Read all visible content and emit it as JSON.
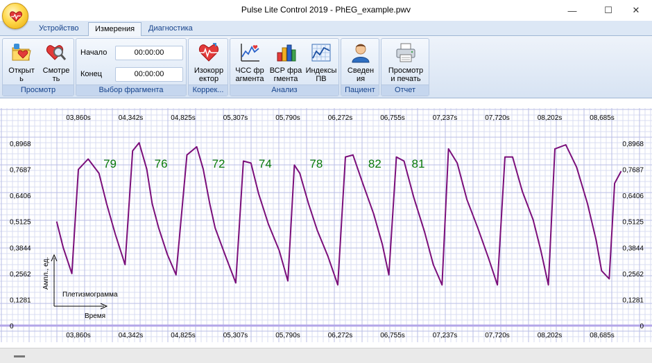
{
  "window": {
    "title": "Pulse Lite Control 2019 - PhEG_example.pwv",
    "minimize_glyph": "—",
    "maximize_glyph": "☐",
    "close_glyph": "✕"
  },
  "tabs": [
    {
      "label": "Устройство",
      "active": false
    },
    {
      "label": "Измерения",
      "active": true
    },
    {
      "label": "Диагностика",
      "active": false
    }
  ],
  "ribbon": {
    "view_group": {
      "label": "Просмотр",
      "open_button": "Открыт\nь",
      "view_button": "Смотре\nть",
      "open_icon": "folder-heart-icon",
      "view_icon": "heart-magnifier-icon"
    },
    "fragment_group": {
      "label": "Выбор фрагмента",
      "start_label": "Начало",
      "start_value": "00:00:00",
      "end_label": "Конец",
      "end_value": "00:00:00"
    },
    "correct_group": {
      "label": "Коррек...",
      "corrector_button": "Изокорр\nектор",
      "corrector_icon": "heart-pulse-icon"
    },
    "analysis_group": {
      "label": "Анализ",
      "hr_button": "ЧСС фр\nагмента",
      "hrv_button": "ВСР фра\nгмента",
      "pw_button": "Индексы\nПВ",
      "hr_icon": "line-chart-icon",
      "hrv_icon": "bar-chart-icon",
      "pw_icon": "grid-chart-icon"
    },
    "patient_group": {
      "label": "Пациент",
      "info_button": "Сведен\nия",
      "info_icon": "person-icon"
    },
    "report_group": {
      "label": "Отчет",
      "print_button": "Просмотр\nи печать",
      "print_icon": "printer-icon"
    }
  },
  "chart_data": {
    "type": "line",
    "x_ticks": [
      "03,860s",
      "04,342s",
      "04,825s",
      "05,307s",
      "05,790s",
      "06,272s",
      "06,755s",
      "07,237s",
      "07,720s",
      "08,202s",
      "08,685s"
    ],
    "y_ticks": [
      "0",
      "0,1281",
      "0,2562",
      "0,3844",
      "0,5125",
      "0,6406",
      "0,7687",
      "0,8968"
    ],
    "ylim": [
      0,
      0.8968
    ],
    "ylabel": "Ампл., ед.",
    "xlabel": "Время",
    "series_caption": "Плетизмограмма",
    "pulse_rates": [
      "79",
      "76",
      "72",
      "74",
      "78",
      "82",
      "81"
    ],
    "line_color": "#7a0e7a",
    "grid": true,
    "x_seconds": [
      3.66,
      3.72,
      3.8,
      3.86,
      3.95,
      4.05,
      4.12,
      4.2,
      4.29,
      4.36,
      4.42,
      4.49,
      4.54,
      4.6,
      4.68,
      4.76,
      4.86,
      4.95,
      5.01,
      5.07,
      5.12,
      5.21,
      5.31,
      5.38,
      5.45,
      5.52,
      5.61,
      5.71,
      5.79,
      5.85,
      5.9,
      5.98,
      6.06,
      6.16,
      6.25,
      6.32,
      6.39,
      6.48,
      6.58,
      6.66,
      6.72,
      6.79,
      6.86,
      6.95,
      7.05,
      7.13,
      7.21,
      7.27,
      7.35,
      7.44,
      7.54,
      7.64,
      7.72,
      7.79,
      7.86,
      7.95,
      8.05,
      8.12,
      8.19,
      8.25,
      8.35,
      8.45,
      8.55,
      8.63,
      8.68,
      8.75,
      8.8,
      8.86
    ],
    "values": [
      0.5125,
      0.3844,
      0.2562,
      0.7687,
      0.82,
      0.75,
      0.6,
      0.45,
      0.3,
      0.86,
      0.9,
      0.77,
      0.6,
      0.48,
      0.35,
      0.25,
      0.84,
      0.88,
      0.77,
      0.6,
      0.48,
      0.35,
      0.21,
      0.81,
      0.8,
      0.65,
      0.5,
      0.37,
      0.22,
      0.79,
      0.75,
      0.6,
      0.47,
      0.34,
      0.2,
      0.83,
      0.84,
      0.7,
      0.55,
      0.4,
      0.25,
      0.83,
      0.81,
      0.63,
      0.46,
      0.3,
      0.2,
      0.87,
      0.8,
      0.62,
      0.48,
      0.33,
      0.2,
      0.83,
      0.83,
      0.66,
      0.52,
      0.37,
      0.2,
      0.87,
      0.89,
      0.78,
      0.6,
      0.42,
      0.27,
      0.23,
      0.7,
      0.76
    ]
  }
}
